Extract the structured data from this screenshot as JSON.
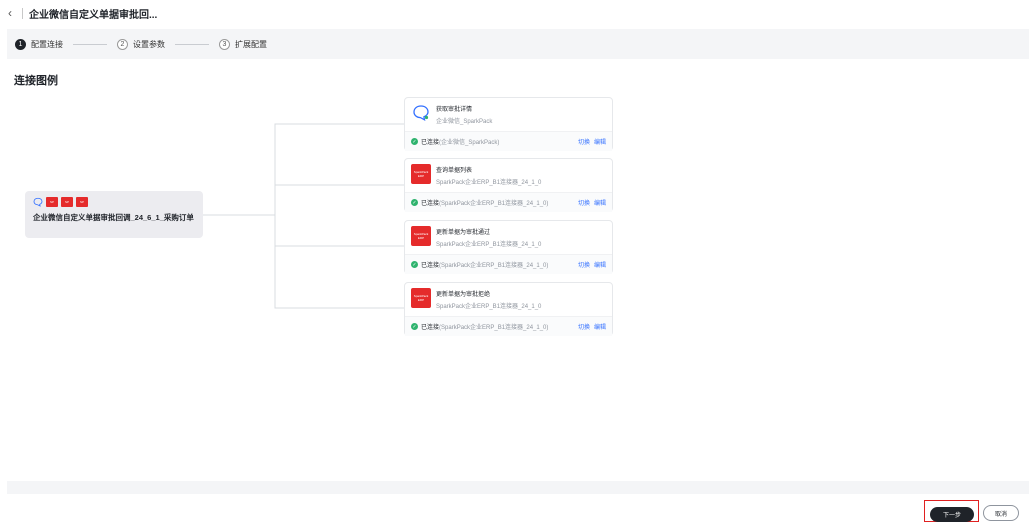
{
  "header": {
    "back_icon": "‹",
    "title": "企业微信自定义单据审批回..."
  },
  "steps": [
    {
      "num": "1",
      "label": "配置连接",
      "active": true
    },
    {
      "num": "2",
      "label": "设置参数",
      "active": false
    },
    {
      "num": "3",
      "label": "扩展配置",
      "active": false
    }
  ],
  "section_title": "连接图例",
  "source": {
    "name": "企业微信自定义单据审批回调_24_6_1_采购订单",
    "icons": [
      "chat-bubble-icon",
      "sparkpack-icon",
      "sparkpack-icon",
      "sparkpack-icon"
    ]
  },
  "cards": [
    {
      "name": "获取审批详情",
      "sub": "企业微信_SparkPack",
      "icon": "chat-bubble-icon",
      "status": "已连接",
      "connection": "(企业微信_SparkPack)",
      "switch": "切换",
      "edit": "编辑"
    },
    {
      "name": "查询单据列表",
      "sub": "SparkPack企业ERP_B1连接器_24_1_0",
      "icon": "sparkpack-icon",
      "status": "已连接",
      "connection": "(SparkPack企业ERP_B1连接器_24_1_0)",
      "switch": "切换",
      "edit": "编辑"
    },
    {
      "name": "更新单据为审批通过",
      "sub": "SparkPack企业ERP_B1连接器_24_1_0",
      "icon": "sparkpack-icon",
      "status": "已连接",
      "connection": "(SparkPack企业ERP_B1连接器_24_1_0)",
      "switch": "切换",
      "edit": "编辑"
    },
    {
      "name": "更新单据为审批拒绝",
      "sub": "SparkPack企业ERP_B1连接器_24_1_0",
      "icon": "sparkpack-icon",
      "status": "已连接",
      "connection": "(SparkPack企业ERP_B1连接器_24_1_0)",
      "switch": "切换",
      "edit": "编辑"
    }
  ],
  "footer": {
    "next": "下一步",
    "cancel": "取消"
  },
  "colors": {
    "primary_dark": "#1f2329",
    "link": "#3370ff",
    "success": "#2fb36e",
    "sparkpack_red": "#e52b2b",
    "highlight_border": "#e02020"
  }
}
